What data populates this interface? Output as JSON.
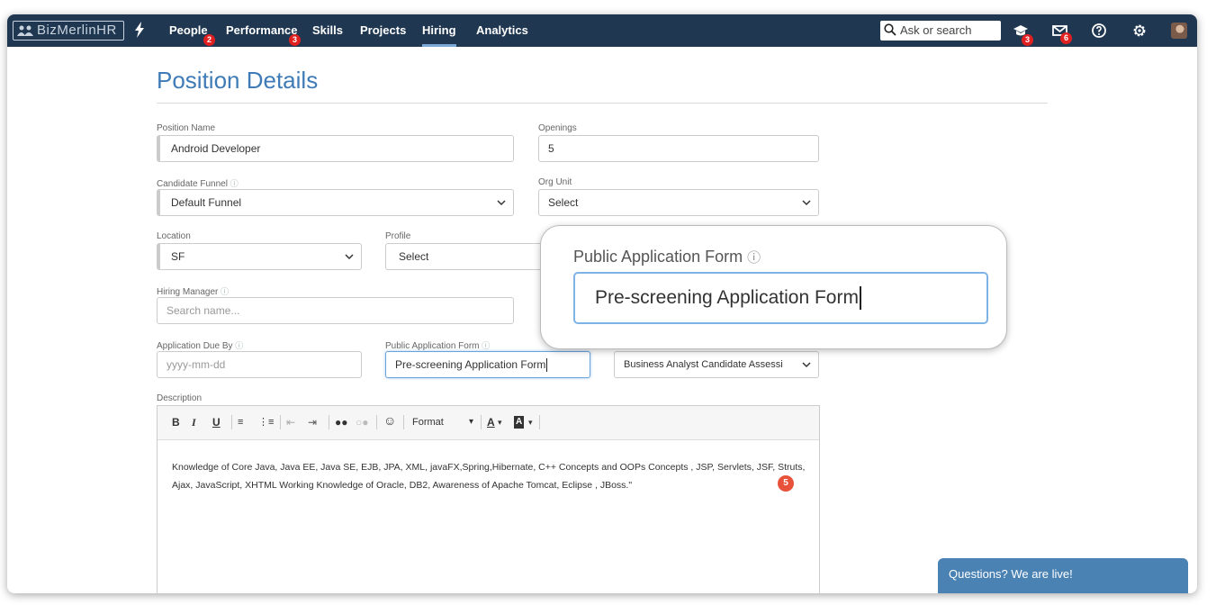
{
  "nav": {
    "logo_text": "BizMerlinHR",
    "items": [
      {
        "label": "People",
        "badge": "2"
      },
      {
        "label": "Performance",
        "badge": "3"
      },
      {
        "label": "Skills"
      },
      {
        "label": "Projects"
      },
      {
        "label": "Hiring",
        "active": true
      },
      {
        "label": "Analytics"
      }
    ],
    "search_placeholder": "Ask or search",
    "notifications_badge": "3",
    "messages_badge": "6"
  },
  "page": {
    "title": "Position Details"
  },
  "form": {
    "position_name": {
      "label": "Position Name",
      "value": "Android Developer"
    },
    "openings": {
      "label": "Openings",
      "value": "5"
    },
    "candidate_funnel": {
      "label": "Candidate Funnel",
      "value": "Default Funnel"
    },
    "org_unit": {
      "label": "Org Unit",
      "value": "Select"
    },
    "location": {
      "label": "Location",
      "value": "SF"
    },
    "profile": {
      "label": "Profile",
      "value": "Select"
    },
    "hiring_manager": {
      "label": "Hiring Manager",
      "placeholder": "Search name..."
    },
    "application_due_by": {
      "label": "Application Due By",
      "placeholder": "yyyy-mm-dd"
    },
    "public_application_form": {
      "label": "Public Application Form",
      "value": "Pre-screening Application Form"
    },
    "assessment": {
      "value": "Business Analyst Candidate Assessi"
    },
    "description": {
      "label": "Description",
      "format_label": "Format",
      "text": "Knowledge of Core Java, Java EE, Java SE, EJB, JPA, XML, javaFX,Spring,Hibernate, C++ Concepts and OOPs Concepts , JSP, Servlets, JSF, Struts, Ajax, JavaScript, XHTML Working Knowledge of Oracle, DB2, Awareness of Apache Tomcat, Eclipse , JBoss.\""
    }
  },
  "callout": {
    "label": "Public Application Form",
    "value": "Pre-screening Application Form"
  },
  "step_marker": "5",
  "chat": {
    "label": "Questions? We are live!"
  },
  "colors": {
    "nav_bg": "#1f3751",
    "title": "#3f7bb6",
    "badge": "#e02020",
    "chat_bg": "#4b82b4",
    "step_marker": "#e8513a"
  }
}
